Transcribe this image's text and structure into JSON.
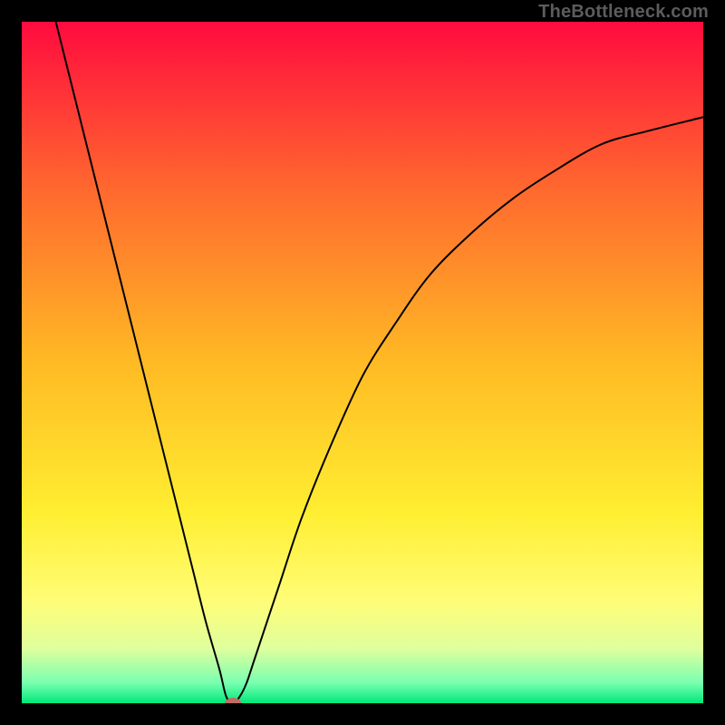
{
  "watermark": "TheBottleneck.com",
  "chart_data": {
    "type": "line",
    "title": "",
    "subtitle": "",
    "xlabel": "",
    "ylabel": "",
    "xlim": [
      0,
      100
    ],
    "ylim": [
      0,
      100
    ],
    "grid": false,
    "legend": false,
    "background": {
      "type": "vertical-gradient",
      "stops": [
        {
          "pos": 0.0,
          "color": "#ff0b3e"
        },
        {
          "pos": 0.25,
          "color": "#ff6a2e"
        },
        {
          "pos": 0.5,
          "color": "#ffba24"
        },
        {
          "pos": 0.72,
          "color": "#ffee31"
        },
        {
          "pos": 0.85,
          "color": "#fffd77"
        },
        {
          "pos": 0.92,
          "color": "#dfff9d"
        },
        {
          "pos": 0.97,
          "color": "#79ffb0"
        },
        {
          "pos": 1.0,
          "color": "#00e87a"
        }
      ]
    },
    "series": [
      {
        "name": "curve",
        "color": "#000000",
        "stroke_width": 2,
        "x": [
          5,
          7,
          10,
          13,
          16,
          19,
          22,
          25,
          27,
          29,
          30,
          31,
          32,
          33,
          34,
          36,
          38,
          41,
          45,
          50,
          55,
          60,
          66,
          72,
          78,
          85,
          92,
          100
        ],
        "y": [
          100,
          92,
          80,
          68,
          56,
          44,
          32,
          20,
          12,
          5,
          1,
          0,
          1,
          3,
          6,
          12,
          18,
          27,
          37,
          48,
          56,
          63,
          69,
          74,
          78,
          82,
          84,
          86
        ]
      }
    ],
    "annotations": [
      {
        "name": "minimum-marker",
        "type": "ellipse",
        "x": 31,
        "y": 0,
        "rx": 1.2,
        "ry": 0.8,
        "fill": "#c06a65"
      }
    ],
    "axes_visible": false
  }
}
